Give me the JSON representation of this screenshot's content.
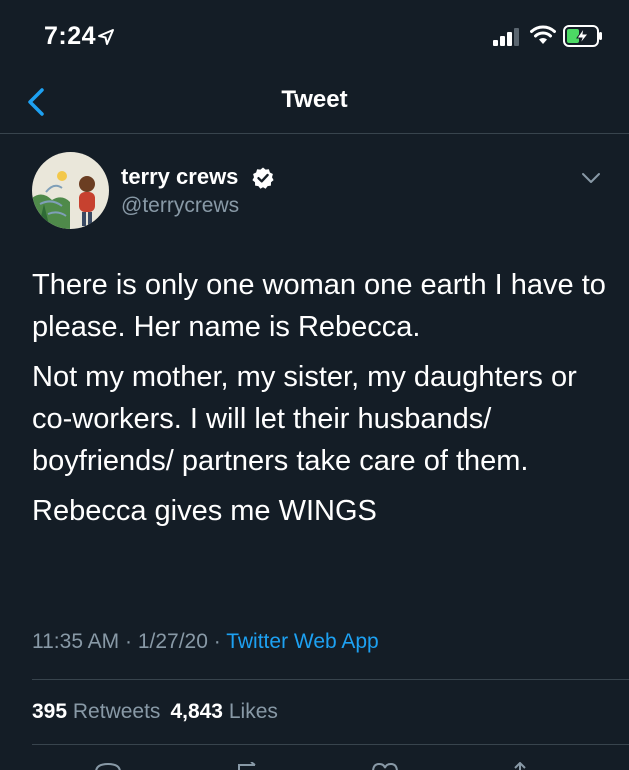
{
  "status_bar": {
    "time": "7:24"
  },
  "header": {
    "title": "Tweet"
  },
  "tweet": {
    "author_name": "terry crews",
    "author_handle": "@terrycrews",
    "paragraphs": [
      "There is only one woman one earth I have to please. Her name is Rebecca.",
      "Not my mother, my sister, my daughters or co-workers. I will let their husbands/ boyfriends/ partners take care of them.",
      "Rebecca gives me WINGS"
    ],
    "time": "11:35 AM",
    "separator": " · ",
    "date": "1/27/20",
    "source": "Twitter Web App"
  },
  "stats": {
    "retweets_count": "395",
    "retweets_label": "Retweets",
    "likes_count": "4,843",
    "likes_label": "Likes"
  },
  "colors": {
    "background": "#141d26",
    "accent": "#1da1f2",
    "secondary_text": "#8899a6",
    "divider": "#38444d"
  },
  "icons": [
    "location-arrow-icon",
    "cellular-signal-icon",
    "wifi-icon",
    "battery-charging-icon",
    "back-chevron-icon",
    "verified-badge-icon",
    "caret-down-icon",
    "reply-icon",
    "retweet-icon",
    "like-icon",
    "share-icon"
  ]
}
